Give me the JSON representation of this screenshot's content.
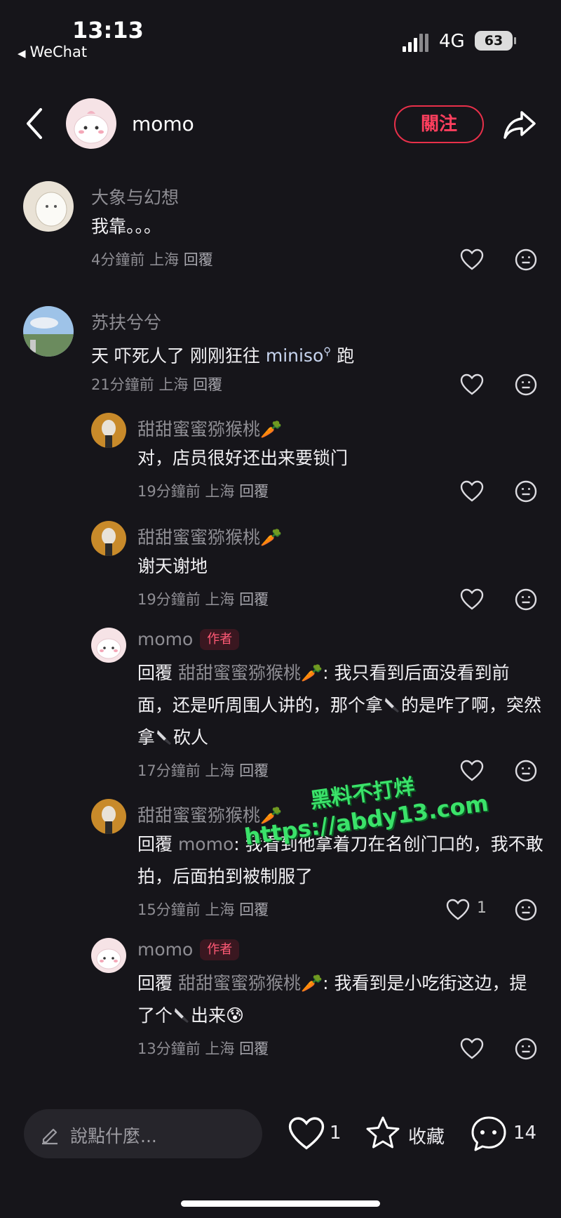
{
  "status_bar": {
    "time": "13:13",
    "back_app": "WeChat",
    "network": "4G",
    "battery": "63"
  },
  "header": {
    "username": "momo",
    "follow_label": "關注"
  },
  "comments": [
    {
      "name": "大象与幻想",
      "text": "我靠。。。",
      "time": "4分鐘前",
      "location": "上海",
      "reply": "回覆"
    },
    {
      "name": "苏扶兮兮",
      "text_before": "天 吓死人了 刚刚狂往 ",
      "link": "miniso",
      "text_after": " 跑",
      "time": "21分鐘前",
      "location": "上海",
      "reply": "回覆"
    },
    {
      "name": "甜甜蜜蜜猕猴桃🥕",
      "text": "对，店员很好还出来要锁门",
      "time": "19分鐘前",
      "location": "上海",
      "reply": "回覆"
    },
    {
      "name": "甜甜蜜蜜猕猴桃🥕",
      "text": "谢天谢地",
      "time": "19分鐘前",
      "location": "上海",
      "reply": "回覆"
    },
    {
      "name": "momo",
      "tag": "作者",
      "reply_prefix": "回覆 ",
      "reply_to": "甜甜蜜蜜猕猴桃🥕",
      "text_a": ": 我只看到后面没看到前面，还是听周围人讲的，那个拿",
      "text_b": "的是咋了啊，突然拿",
      "text_c": "砍人",
      "time": "17分鐘前",
      "location": "上海",
      "reply": "回覆"
    },
    {
      "name": "甜甜蜜蜜猕猴桃🥕",
      "reply_prefix": "回覆 ",
      "reply_to": "momo",
      "text": ": 我看到他拿着刀在名创门口的，我不敢拍，后面拍到被制服了",
      "time": "15分鐘前",
      "location": "上海",
      "reply": "回覆",
      "likes": "1"
    },
    {
      "name": "momo",
      "tag": "作者",
      "reply_prefix": "回覆 ",
      "reply_to": "甜甜蜜蜜猕猴桃🥕",
      "text_a": ": 我看到是小吃街这边，提了个",
      "text_b": "出来😰",
      "time": "13分鐘前",
      "location": "上海",
      "reply": "回覆"
    }
  ],
  "bottom_bar": {
    "placeholder": "說點什麼...",
    "likes": "1",
    "collect_label": "收藏",
    "comments_count": "14"
  },
  "watermark": {
    "line1": "黑料不打烊",
    "line2": "https://abdy13.com"
  },
  "colors": {
    "accent": "#ff3f5e",
    "background": "#16151a",
    "watermark": "#3be26a"
  }
}
